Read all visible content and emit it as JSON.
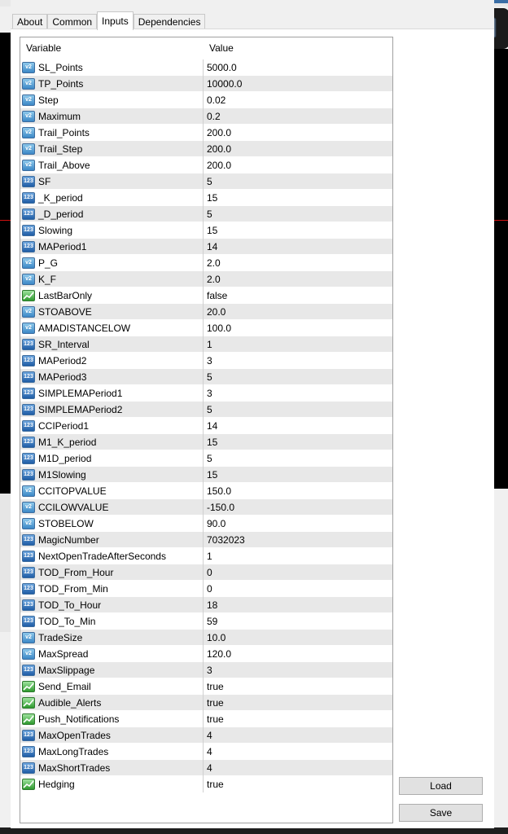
{
  "tabs": [
    {
      "label": "About"
    },
    {
      "label": "Common"
    },
    {
      "label": "Inputs"
    },
    {
      "label": "Dependencies"
    }
  ],
  "grid": {
    "header": {
      "variable": "Variable",
      "value": "Value"
    },
    "rows": [
      {
        "name": "SL_Points",
        "value": "5000.0",
        "type": "double"
      },
      {
        "name": "TP_Points",
        "value": "10000.0",
        "type": "double"
      },
      {
        "name": "Step",
        "value": "0.02",
        "type": "double"
      },
      {
        "name": "Maximum",
        "value": "0.2",
        "type": "double"
      },
      {
        "name": "Trail_Points",
        "value": "200.0",
        "type": "double"
      },
      {
        "name": "Trail_Step",
        "value": "200.0",
        "type": "double"
      },
      {
        "name": "Trail_Above",
        "value": "200.0",
        "type": "double"
      },
      {
        "name": "SF",
        "value": "5",
        "type": "int"
      },
      {
        "name": "_K_period",
        "value": "15",
        "type": "int"
      },
      {
        "name": "_D_period",
        "value": "5",
        "type": "int"
      },
      {
        "name": "Slowing",
        "value": "15",
        "type": "int"
      },
      {
        "name": "MAPeriod1",
        "value": "14",
        "type": "int"
      },
      {
        "name": "P_G",
        "value": "2.0",
        "type": "double"
      },
      {
        "name": "K_F",
        "value": "2.0",
        "type": "double"
      },
      {
        "name": "LastBarOnly",
        "value": "false",
        "type": "bool"
      },
      {
        "name": "STOABOVE",
        "value": "20.0",
        "type": "double"
      },
      {
        "name": "AMADISTANCELOW",
        "value": "100.0",
        "type": "double"
      },
      {
        "name": "SR_Interval",
        "value": "1",
        "type": "int"
      },
      {
        "name": "MAPeriod2",
        "value": "3",
        "type": "int"
      },
      {
        "name": "MAPeriod3",
        "value": "5",
        "type": "int"
      },
      {
        "name": "SIMPLEMAPeriod1",
        "value": "3",
        "type": "int"
      },
      {
        "name": "SIMPLEMAPeriod2",
        "value": "5",
        "type": "int"
      },
      {
        "name": "CCIPeriod1",
        "value": "14",
        "type": "int"
      },
      {
        "name": "M1_K_period",
        "value": "15",
        "type": "int"
      },
      {
        "name": "M1D_period",
        "value": "5",
        "type": "int"
      },
      {
        "name": "M1Slowing",
        "value": "15",
        "type": "int"
      },
      {
        "name": "CCITOPVALUE",
        "value": "150.0",
        "type": "double"
      },
      {
        "name": "CCILOWVALUE",
        "value": "-150.0",
        "type": "double"
      },
      {
        "name": "STOBELOW",
        "value": "90.0",
        "type": "double"
      },
      {
        "name": "MagicNumber",
        "value": "7032023",
        "type": "int"
      },
      {
        "name": "NextOpenTradeAfterSeconds",
        "value": "1",
        "type": "int"
      },
      {
        "name": "TOD_From_Hour",
        "value": "0",
        "type": "int"
      },
      {
        "name": "TOD_From_Min",
        "value": "0",
        "type": "int"
      },
      {
        "name": "TOD_To_Hour",
        "value": "18",
        "type": "int"
      },
      {
        "name": "TOD_To_Min",
        "value": "59",
        "type": "int"
      },
      {
        "name": "TradeSize",
        "value": "10.0",
        "type": "double"
      },
      {
        "name": "MaxSpread",
        "value": "120.0",
        "type": "double"
      },
      {
        "name": "MaxSlippage",
        "value": "3",
        "type": "int"
      },
      {
        "name": "Send_Email",
        "value": "true",
        "type": "bool"
      },
      {
        "name": "Audible_Alerts",
        "value": "true",
        "type": "bool"
      },
      {
        "name": "Push_Notifications",
        "value": "true",
        "type": "bool"
      },
      {
        "name": "MaxOpenTrades",
        "value": "4",
        "type": "int"
      },
      {
        "name": "MaxLongTrades",
        "value": "4",
        "type": "int"
      },
      {
        "name": "MaxShortTrades",
        "value": "4",
        "type": "int"
      },
      {
        "name": "Hedging",
        "value": "true",
        "type": "bool"
      }
    ]
  },
  "buttons": {
    "load": "Load",
    "save": "Save"
  },
  "icons": {
    "double": "v2",
    "int": "123",
    "bool": "check-arrow"
  },
  "colors": {
    "int_icon": "#1f5da6",
    "double_icon": "#3c88c6",
    "bool_icon": "#2e9a2e",
    "row_alt": "#e8e8e8"
  }
}
